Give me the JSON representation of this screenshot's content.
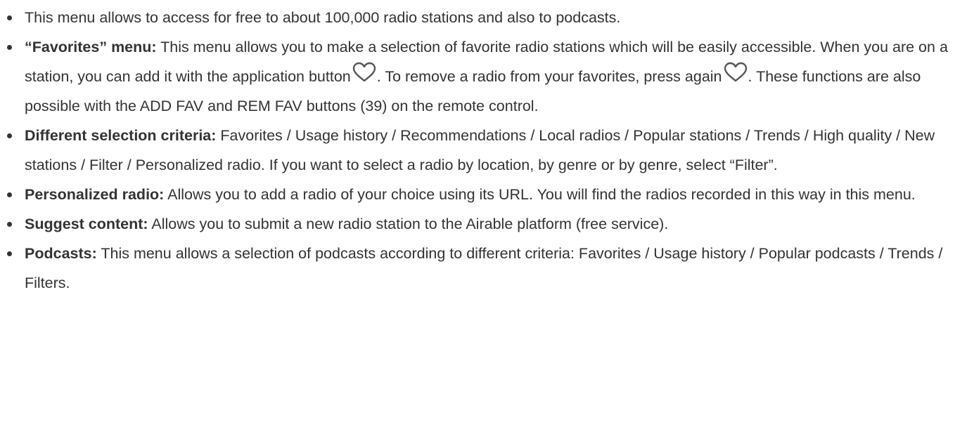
{
  "items": [
    {
      "bold": "",
      "text": "This menu allows to access for free to about 100,000 radio stations and also to podcasts."
    },
    {
      "bold": "“Favorites” menu:",
      "text_a": " This menu allows you to make a selection of favorite radio stations which will be easily accessible. When you are on a station, you can add it with the application button",
      "text_b": ". To remove a radio from your favorites, press again",
      "text_c": ". These functions are also possible with the ADD FAV and REM FAV buttons (39) on the remote control.",
      "icon": "heart-outline-icon"
    },
    {
      "bold": "Different selection criteria:",
      "text": " Favorites / Usage history / Recommendations / Local radios / Popular stations / Trends / High quality / New stations / Filter / Personalized radio. If you want to select a radio by location, by genre or by genre, select “Filter”."
    },
    {
      "bold": "Personalized radio:",
      "text": " Allows you to add a radio of your choice using its URL. You will find the radios recorded in this way in this menu."
    },
    {
      "bold": "Suggest content:",
      "text": " Allows you to submit a new radio station to the Airable platform (free service)."
    },
    {
      "bold": "Podcasts:",
      "text": " This menu allows a selection of podcasts according to different criteria: Favorites / Usage history / Popular podcasts / Trends / Filters."
    }
  ],
  "colors": {
    "text": "#333333",
    "icon_stroke": "#555555",
    "background": "#ffffff"
  }
}
